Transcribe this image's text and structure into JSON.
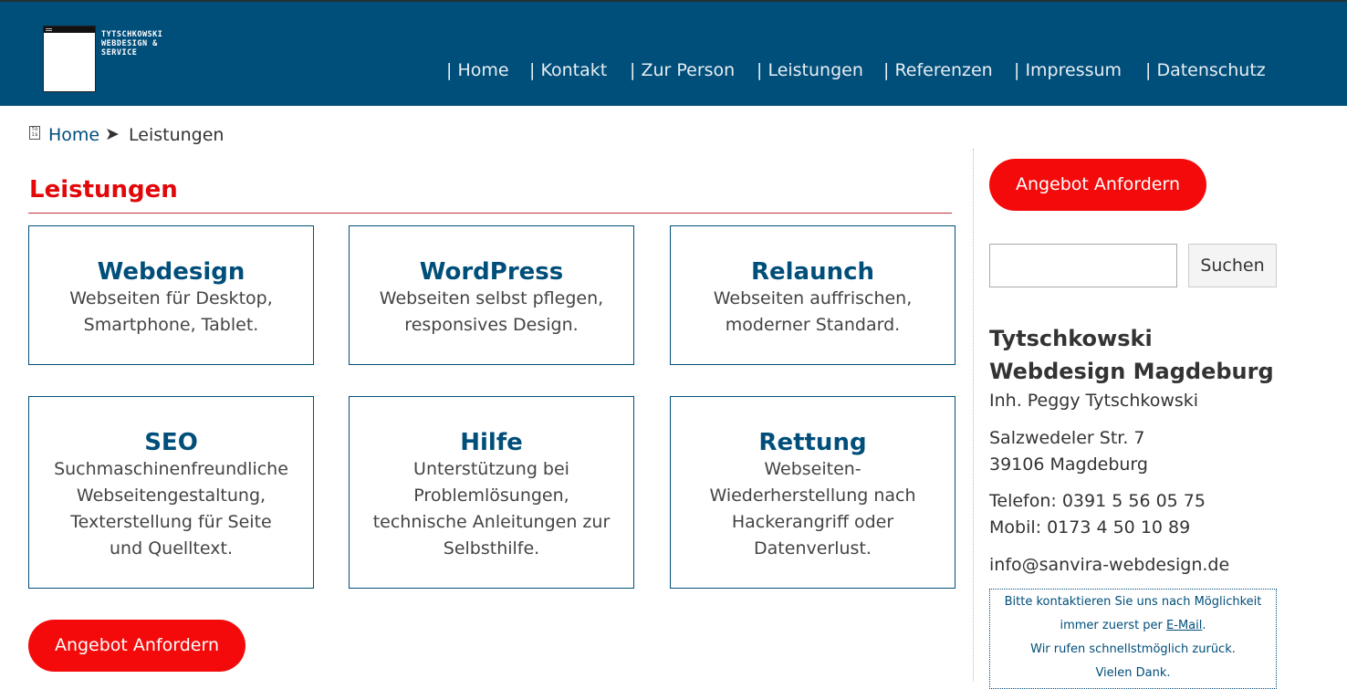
{
  "brand": {
    "logo_lines": [
      "TYTSCHKOWSKI",
      "WEBDESIGN &",
      "SERVICE"
    ]
  },
  "nav": {
    "items": [
      "| Home",
      "| Kontakt",
      "| Zur Person",
      "| Leistungen",
      "| Referenzen",
      "| Impressum",
      "| Datenschutz"
    ]
  },
  "breadcrumb": {
    "home": "Home",
    "separator": "➤",
    "current": "Leistungen"
  },
  "page": {
    "title": "Leistungen"
  },
  "cards": [
    {
      "title": "Webdesign",
      "lines": [
        "Webseiten für Desktop,",
        "Smartphone, Tablet."
      ]
    },
    {
      "title": "WordPress",
      "lines": [
        "Webseiten selbst pflegen,",
        "responsives Design."
      ]
    },
    {
      "title": "Relaunch",
      "lines": [
        "Webseiten auffrischen,",
        "moderner Standard."
      ]
    },
    {
      "title": "SEO",
      "lines": [
        "Suchmaschinenfreundliche",
        "Webseitengestaltung,",
        "Texterstellung für Seite",
        "und Quelltext."
      ]
    },
    {
      "title": "Hilfe",
      "lines": [
        "Unterstützung bei",
        "Problemlösungen,",
        "technische Anleitungen zur",
        "Selbsthilfe."
      ]
    },
    {
      "title": "Rettung",
      "lines": [
        "Webseiten-",
        "Wiederherstellung nach",
        "Hackerangriff oder",
        "Datenverlust."
      ]
    }
  ],
  "cta": {
    "label": "Angebot Anfordern"
  },
  "sidebar": {
    "cta_label": "Angebot Anfordern",
    "search_value": "",
    "search_button": "Suchen",
    "company_line1": "Tytschkowski",
    "company_line2": "Webdesign Magdeburg",
    "owner": "Inh. Peggy Tytschkowski",
    "street": "Salzwedeler Str. 7",
    "city": "39106 Magdeburg",
    "phone": "Telefon: 0391 5 56 05 75",
    "mobile": "Mobil: 0173 4 50 10 89",
    "email": "info@sanvira-webdesign.de",
    "note": {
      "line1": "Bitte kontaktieren Sie uns nach Möglichkeit",
      "line2_pre": "immer zuerst per ",
      "line2_link": "E-Mail",
      "line2_post": ".",
      "line3": "Wir rufen schnellstmöglich zurück.",
      "line4": "Vielen Dank."
    }
  },
  "colors": {
    "header_bg": "#004e7a",
    "accent_red": "#f40a0a",
    "title_red": "#e1070a",
    "link_blue": "#004e7a"
  }
}
